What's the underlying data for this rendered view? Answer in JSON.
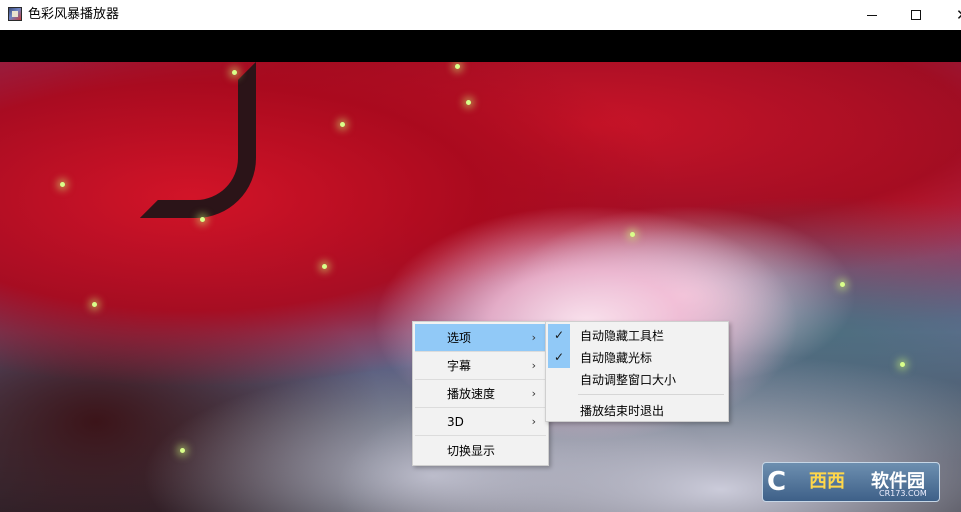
{
  "window": {
    "title": "色彩风暴播放器",
    "icon": "app-icon",
    "controls": {
      "minimize": "minimize-icon",
      "maximize": "maximize-icon",
      "close": "✕"
    }
  },
  "context_menu": {
    "items": [
      {
        "label": "选项",
        "has_submenu": true,
        "highlighted": true
      },
      {
        "label": "字幕",
        "has_submenu": true
      },
      {
        "label": "播放速度",
        "has_submenu": true
      },
      {
        "label": "3D",
        "has_submenu": true
      },
      {
        "label": "切换显示",
        "has_submenu": false
      }
    ],
    "arrow": "›"
  },
  "submenu": {
    "items": [
      {
        "label": "自动隐藏工具栏",
        "checked": true
      },
      {
        "label": "自动隐藏光标",
        "checked": true
      },
      {
        "label": "自动调整窗口大小",
        "checked": false
      },
      {
        "label": "播放结束时退出",
        "checked": false
      }
    ],
    "check_glyph": "✓"
  },
  "watermark": {
    "logo": "C",
    "text_yellow": "西西",
    "text_white": "软件园",
    "url": "CR173.COM"
  },
  "colors": {
    "highlight": "#91c9f7",
    "menu_bg": "#f2f2f2"
  }
}
